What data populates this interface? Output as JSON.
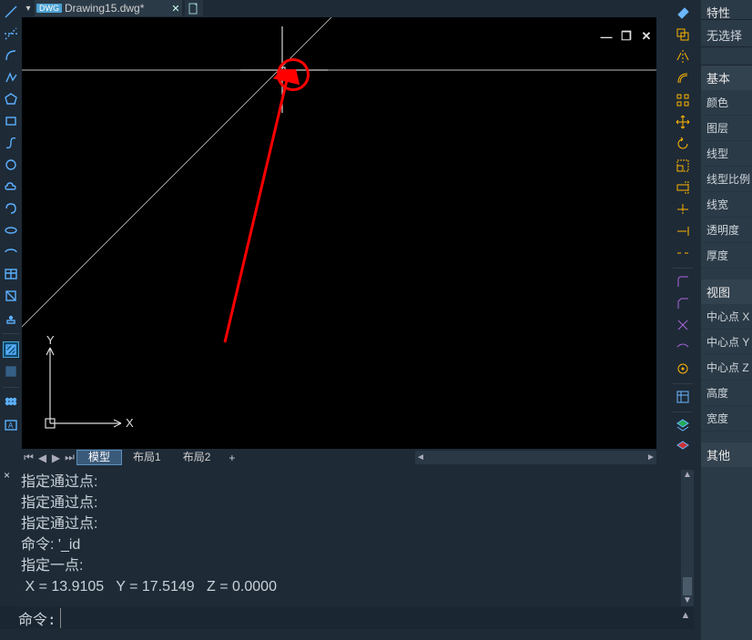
{
  "doc": {
    "dropdown_glyph": "▾",
    "badge": "DWG",
    "title": "Drawing15.dwg*",
    "close_glyph": "✕"
  },
  "win": {
    "min": "—",
    "max": "❐",
    "close": "✕"
  },
  "ucs": {
    "x": "X",
    "y": "Y"
  },
  "layout": {
    "nav_first": "⏮",
    "nav_prev": "◀",
    "nav_next": "▶",
    "nav_last": "⏭",
    "tabs": [
      "模型",
      "布局1",
      "布局2"
    ],
    "add": "+",
    "scroll_l": "◄",
    "scroll_r": "►"
  },
  "cmd": {
    "close": "×",
    "history": [
      "指定通过点:",
      "指定通过点:",
      "指定通过点:",
      "命令: '_id",
      "指定一点:",
      " X = 13.9105   Y = 17.5149   Z = 0.0000"
    ],
    "prompt": "命令:",
    "input_value": "",
    "up": "▲",
    "dn": "▼",
    "expand": "▲"
  },
  "props": {
    "header": "特性",
    "selection": "无选择",
    "section_basic": "基本",
    "basic_items": [
      "颜色",
      "图层",
      "线型",
      "线型比例",
      "线宽",
      "透明度",
      "厚度"
    ],
    "section_view": "视图",
    "view_items": [
      "中心点 X",
      "中心点 Y",
      "中心点 Z",
      "高度",
      "宽度"
    ],
    "section_other": "其他"
  },
  "left_icons": [
    "line",
    "xline",
    "arc",
    "poly",
    "polygon",
    "arc2",
    "spline",
    "circle",
    "cloud",
    "offset",
    "ellipse",
    "ellipse-arc",
    "rect",
    "rect2",
    "copy",
    "mirror",
    "array",
    "hatch",
    "grid",
    "text"
  ],
  "mid_icons_top": [
    "eraser",
    "group",
    "move",
    "rotate",
    "scale",
    "stretch",
    "trim",
    "extend",
    "fillet",
    "chamfer",
    "explode"
  ],
  "mid_icons_g2": [
    "dim-linear",
    "dim-aligned",
    "dim-angular",
    "dim-radius",
    "dim-diam"
  ],
  "mid_icons_g3": [
    "layer",
    "layer-on"
  ],
  "mid_icons_g4": [
    "color1",
    "color2"
  ]
}
